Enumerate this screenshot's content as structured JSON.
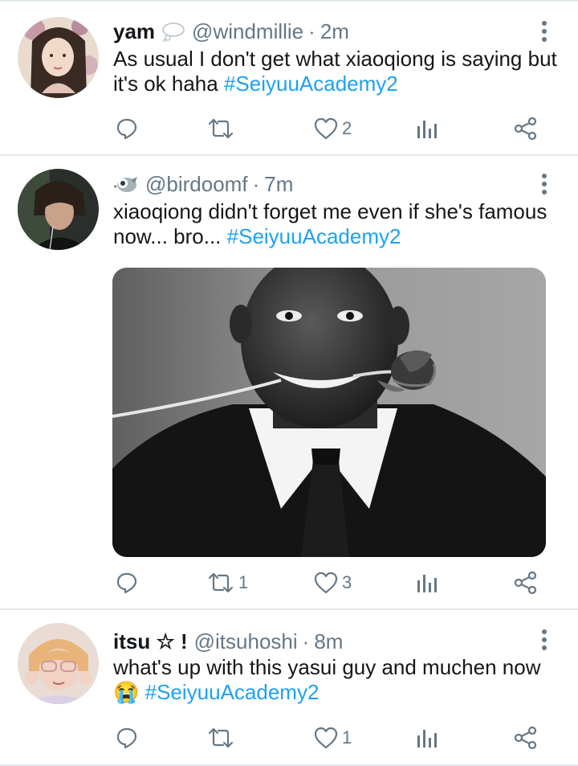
{
  "tweets": [
    {
      "name": "yam",
      "name_emoji": "thought-balloon-icon",
      "handle": "@windmillie",
      "separator": "·",
      "time": "2m",
      "text": "As usual I don't get what xiaoqiong is saying but it's ok haha",
      "hashtag": "#SeiyuuAcademy2",
      "counts": {
        "reply": "",
        "retweet": "",
        "like": "2"
      }
    },
    {
      "name": "",
      "name_emoji": "bird-icon",
      "handle": "@birdoomf",
      "separator": "·",
      "time": "7m",
      "text": "xiaoqiong didn't forget me even if she's famous now... bro...",
      "hashtag": "#SeiyuuAcademy2",
      "media": "black-and-white photo of a smiling man in a suit holding a rose in his teeth",
      "counts": {
        "reply": "",
        "retweet": "1",
        "like": "3"
      }
    },
    {
      "name": "itsu ☆ !",
      "handle": "@itsuhoshi",
      "separator": "·",
      "time": "8m",
      "text": "what's up with this yasui guy and muchen now",
      "text_emoji": "😭",
      "hashtag": "#SeiyuuAcademy2",
      "counts": {
        "reply": "",
        "retweet": "",
        "like": "1"
      }
    }
  ],
  "colors": {
    "text": "#14171a",
    "secondary": "#657786",
    "hashtag": "#1da1f2",
    "divider": "#e1e8ed"
  }
}
